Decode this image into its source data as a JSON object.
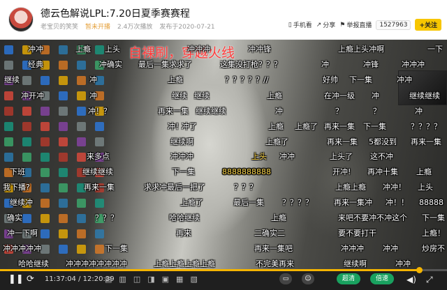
{
  "header": {
    "title": "德云色解说LPL:7.20日夏季赛赛程",
    "author": "老宝贝的笑笑",
    "status": "暂未开播",
    "plays": "2.4万次播放",
    "published": "发布于2020-07-21",
    "tools": {
      "mobile": "手机看",
      "share": "分享",
      "report": "举报直播",
      "count": "1527963",
      "follow": "+关注"
    }
  },
  "video": {
    "overlay_title": "自裸刷，穿越火线",
    "danmaku": [
      [
        "冲冲",
        40,
        8
      ],
      [
        "上瘾",
        108,
        8
      ],
      [
        "上头",
        150,
        8
      ],
      [
        "冲冲冲",
        268,
        8
      ],
      [
        "冲冲锋",
        355,
        8
      ],
      [
        "上瘾上头冲啊",
        484,
        8
      ],
      [
        "一下",
        612,
        8
      ],
      [
        "经典",
        40,
        30
      ],
      [
        "冲确实",
        142,
        30
      ],
      [
        "最后一集求求了",
        198,
        30
      ],
      [
        "这集没打枪？？？",
        315,
        30
      ],
      [
        "冲",
        460,
        30
      ],
      [
        "冲锋",
        520,
        30
      ],
      [
        "冲冲冲",
        575,
        30
      ],
      [
        "继续",
        6,
        52
      ],
      [
        "冲",
        128,
        52
      ],
      [
        "上瘾",
        240,
        52
      ],
      [
        "？？？？？//",
        322,
        52
      ],
      [
        "好帅",
        462,
        52
      ],
      [
        "下一集",
        500,
        52
      ],
      [
        "冲冲",
        568,
        52
      ],
      [
        "冲开冲",
        30,
        75
      ],
      [
        "冲",
        128,
        75
      ],
      [
        "继续",
        246,
        75
      ],
      [
        "继续",
        278,
        75
      ],
      [
        "上瘾",
        382,
        75
      ],
      [
        "在冲一级",
        464,
        75
      ],
      [
        "冲",
        532,
        75
      ],
      [
        "继续继续",
        586,
        75
      ],
      [
        "冲！",
        126,
        97
      ],
      [
        "？",
        148,
        97
      ],
      [
        "再来一集",
        226,
        97
      ],
      [
        "继续继续",
        280,
        97
      ],
      [
        "冲",
        394,
        97
      ],
      [
        "？",
        480,
        97
      ],
      [
        "？",
        534,
        97
      ],
      [
        "冲",
        594,
        97
      ],
      [
        "冲！",
        240,
        119
      ],
      [
        "冲了",
        260,
        119
      ],
      [
        "上瘾",
        384,
        119
      ],
      [
        "上瘾了",
        422,
        119
      ],
      [
        "再来一集",
        464,
        119
      ],
      [
        "下一集",
        520,
        119
      ],
      [
        "？？？？",
        588,
        119
      ],
      [
        "继续啊",
        244,
        141
      ],
      [
        "上瘾了",
        380,
        141
      ],
      [
        "再来一集",
        468,
        141
      ],
      [
        "5都没到",
        528,
        141
      ],
      [
        "再来一集",
        588,
        141
      ],
      [
        "来多点",
        124,
        162
      ],
      [
        "冲冲冲",
        244,
        162
      ],
      [
        "冲冲",
        400,
        162
      ],
      [
        "上头了",
        472,
        162
      ],
      [
        "这不冲",
        530,
        162
      ],
      [
        "下班",
        14,
        184
      ],
      [
        "继续继续",
        118,
        184
      ],
      [
        "下一集",
        246,
        184
      ],
      [
        "8888888888",
        318,
        184
      ],
      [
        "开冲!",
        476,
        184
      ],
      [
        "再冲十集",
        526,
        184
      ],
      [
        "上瘾",
        596,
        184
      ],
      [
        "我下播?",
        4,
        206
      ],
      [
        "再来一集",
        120,
        206
      ],
      [
        "求求冲最后一把了",
        206,
        206
      ],
      [
        "？？？",
        335,
        206
      ],
      [
        "上瘾上瘾",
        480,
        206
      ],
      [
        "冲冲！",
        548,
        206
      ],
      [
        "上头",
        598,
        206
      ],
      [
        "继续冲",
        14,
        228
      ],
      [
        "上瘾了",
        258,
        228
      ],
      [
        "最后一集",
        334,
        228
      ],
      [
        "？？？？",
        404,
        228
      ],
      [
        "再来一集冲",
        478,
        228
      ],
      [
        "冲！！",
        552,
        228
      ],
      [
        "88888",
        600,
        228
      ],
      [
        "确实",
        10,
        250
      ],
      [
        "哈哈继续",
        242,
        250
      ],
      [
        "上瘾",
        388,
        250
      ],
      [
        "来吧不要冲不冲这个",
        484,
        250
      ],
      [
        "？？？",
        136,
        250
      ],
      [
        "下一集",
        604,
        250
      ],
      [
        "冲一下啊",
        10,
        272
      ],
      [
        "再来",
        252,
        272
      ],
      [
        "二确实二",
        364,
        272
      ],
      [
        "要不要打干",
        484,
        272
      ],
      [
        "上瘾！",
        604,
        272
      ],
      [
        "冲冲冲冲冲",
        4,
        294
      ],
      [
        "下一集",
        150,
        294
      ],
      [
        "再来一集吧",
        364,
        294
      ],
      [
        "冲冲冲",
        488,
        294
      ],
      [
        "冲冲",
        548,
        294
      ],
      [
        "炒房不",
        604,
        294
      ],
      [
        "哈哈继续",
        26,
        316
      ],
      [
        "冲冲冲冲冲冲冲冲",
        94,
        316
      ],
      [
        "上瘾上瘾上瘾上瘾",
        220,
        316
      ],
      [
        "不完美再来",
        366,
        316
      ],
      [
        "继续啊",
        492,
        316
      ],
      [
        "冲冲",
        566,
        316
      ]
    ],
    "highlight": [
      [
        "上头",
        360,
        162
      ],
      [
        "8888888888",
        318,
        184
      ]
    ]
  },
  "controls": {
    "time": "11:37:04 / 12:20:39",
    "progress": 0.937,
    "btn_quality": "超清",
    "btn_speed": "倍速"
  },
  "colors": {
    "accent": "#f4b400",
    "danmaku_red": "#ff3c3c"
  }
}
